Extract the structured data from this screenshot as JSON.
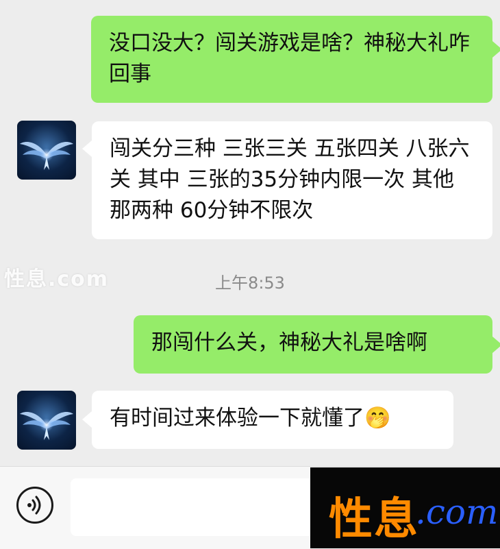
{
  "messages": [
    {
      "direction": "outgoing",
      "text": "没口没大？闯关游戏是啥？神秘大礼咋回事"
    },
    {
      "direction": "incoming",
      "text": "闯关分三种 三张三关 五张四关 八张六关 其中 三张的35分钟内限一次 其他那两种 60分钟不限次"
    },
    {
      "direction": "outgoing",
      "text": "那闯什么关，神秘大礼是啥啊"
    },
    {
      "direction": "incoming",
      "text": "有时间过来体验一下就懂了",
      "emoji": "🤭"
    }
  ],
  "timestamp": "上午8:53",
  "watermark": {
    "cn": "性息",
    "en": ".com"
  },
  "icons": {
    "voice": "voice-icon",
    "avatar": "angel-wings-avatar"
  },
  "colors": {
    "outgoing_bubble": "#95ec69",
    "incoming_bubble": "#ffffff",
    "background": "#ededed",
    "logo_cn": "#ff8a00",
    "logo_en": "#2a5fff"
  }
}
